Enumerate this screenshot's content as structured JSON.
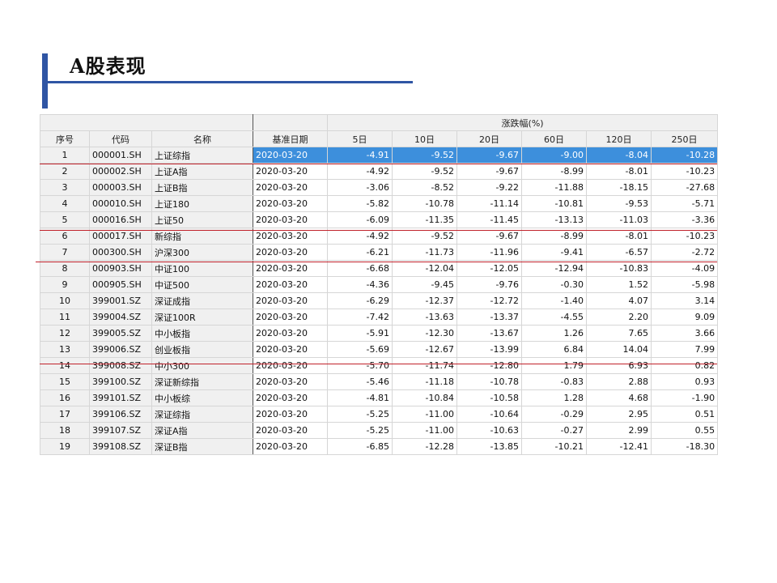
{
  "slide": {
    "title": "A股表现"
  },
  "table": {
    "group_header": "涨跌幅(%)",
    "columns": [
      "序号",
      "代码",
      "名称",
      "基准日期",
      "5日",
      "10日",
      "20日",
      "60日",
      "120日",
      "250日"
    ],
    "selected_row": 0,
    "rows": [
      [
        "1",
        "000001.SH",
        "上证综指",
        "2020-03-20",
        "-4.91",
        "-9.52",
        "-9.67",
        "-9.00",
        "-8.04",
        "-10.28"
      ],
      [
        "2",
        "000002.SH",
        "上证A指",
        "2020-03-20",
        "-4.92",
        "-9.52",
        "-9.67",
        "-8.99",
        "-8.01",
        "-10.23"
      ],
      [
        "3",
        "000003.SH",
        "上证B指",
        "2020-03-20",
        "-3.06",
        "-8.52",
        "-9.22",
        "-11.88",
        "-18.15",
        "-27.68"
      ],
      [
        "4",
        "000010.SH",
        "上证180",
        "2020-03-20",
        "-5.82",
        "-10.78",
        "-11.14",
        "-10.81",
        "-9.53",
        "-5.71"
      ],
      [
        "5",
        "000016.SH",
        "上证50",
        "2020-03-20",
        "-6.09",
        "-11.35",
        "-11.45",
        "-13.13",
        "-11.03",
        "-3.36"
      ],
      [
        "6",
        "000017.SH",
        "新综指",
        "2020-03-20",
        "-4.92",
        "-9.52",
        "-9.67",
        "-8.99",
        "-8.01",
        "-10.23"
      ],
      [
        "7",
        "000300.SH",
        "沪深300",
        "2020-03-20",
        "-6.21",
        "-11.73",
        "-11.96",
        "-9.41",
        "-6.57",
        "-2.72"
      ],
      [
        "8",
        "000903.SH",
        "中证100",
        "2020-03-20",
        "-6.68",
        "-12.04",
        "-12.05",
        "-12.94",
        "-10.83",
        "-4.09"
      ],
      [
        "9",
        "000905.SH",
        "中证500",
        "2020-03-20",
        "-4.36",
        "-9.45",
        "-9.76",
        "-0.30",
        "1.52",
        "-5.98"
      ],
      [
        "10",
        "399001.SZ",
        "深证成指",
        "2020-03-20",
        "-6.29",
        "-12.37",
        "-12.72",
        "-1.40",
        "4.07",
        "3.14"
      ],
      [
        "11",
        "399004.SZ",
        "深证100R",
        "2020-03-20",
        "-7.42",
        "-13.63",
        "-13.37",
        "-4.55",
        "2.20",
        "9.09"
      ],
      [
        "12",
        "399005.SZ",
        "中小板指",
        "2020-03-20",
        "-5.91",
        "-12.30",
        "-13.67",
        "1.26",
        "7.65",
        "3.66"
      ],
      [
        "13",
        "399006.SZ",
        "创业板指",
        "2020-03-20",
        "-5.69",
        "-12.67",
        "-13.99",
        "6.84",
        "14.04",
        "7.99"
      ],
      [
        "14",
        "399008.SZ",
        "中小300",
        "2020-03-20",
        "-5.70",
        "-11.74",
        "-12.80",
        "1.79",
        "6.93",
        "0.82"
      ],
      [
        "15",
        "399100.SZ",
        "深证新综指",
        "2020-03-20",
        "-5.46",
        "-11.18",
        "-10.78",
        "-0.83",
        "2.88",
        "0.93"
      ],
      [
        "16",
        "399101.SZ",
        "中小板综",
        "2020-03-20",
        "-4.81",
        "-10.84",
        "-10.58",
        "1.28",
        "4.68",
        "-1.90"
      ],
      [
        "17",
        "399106.SZ",
        "深证综指",
        "2020-03-20",
        "-5.25",
        "-11.00",
        "-10.64",
        "-0.29",
        "2.95",
        "0.51"
      ],
      [
        "18",
        "399107.SZ",
        "深证A指",
        "2020-03-20",
        "-5.25",
        "-11.00",
        "-10.63",
        "-0.27",
        "2.99",
        "0.55"
      ],
      [
        "19",
        "399108.SZ",
        "深证B指",
        "2020-03-20",
        "-6.85",
        "-12.28",
        "-13.85",
        "-10.21",
        "-12.41",
        "-18.30"
      ]
    ]
  },
  "colors": {
    "accent": "#2f55a4",
    "selection": "#3d8fdc",
    "red_underline": "#c0222b",
    "header_bg": "#f0f0f0"
  }
}
